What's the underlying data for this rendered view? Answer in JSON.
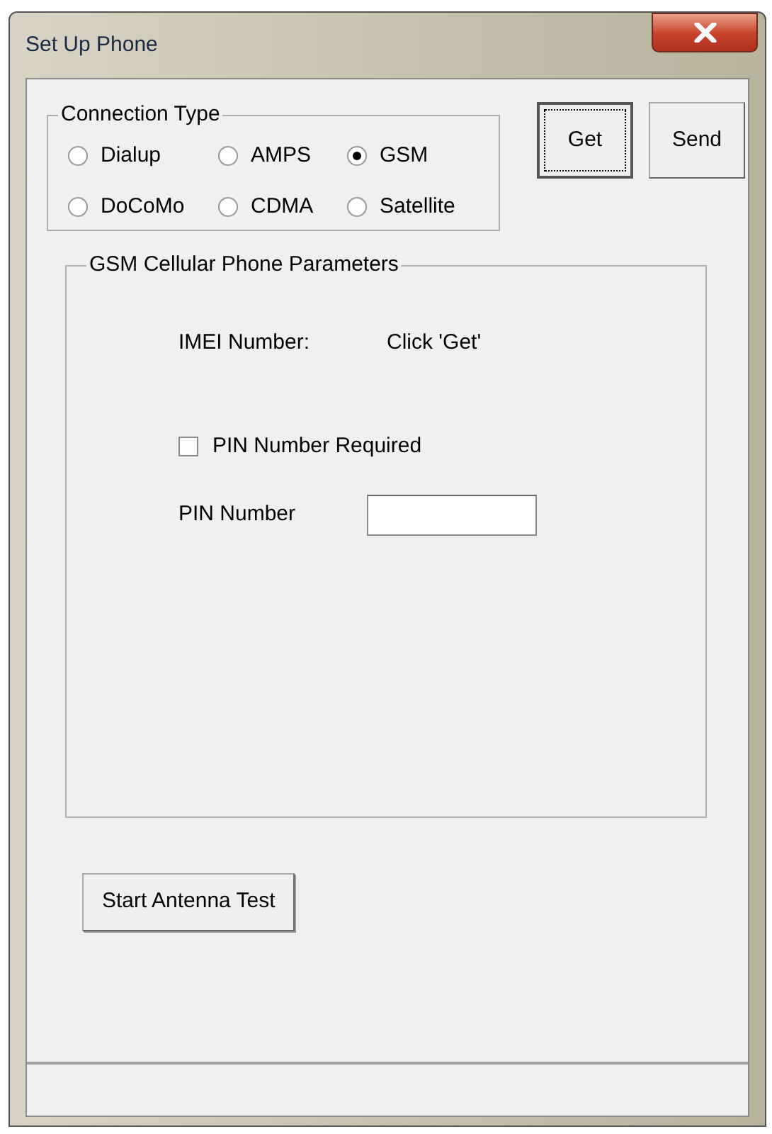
{
  "window": {
    "title": "Set Up Phone"
  },
  "connection_type": {
    "label": "Connection Type",
    "options": [
      {
        "label": "Dialup",
        "selected": false
      },
      {
        "label": "AMPS",
        "selected": false
      },
      {
        "label": "GSM",
        "selected": true
      },
      {
        "label": "DoCoMo",
        "selected": false
      },
      {
        "label": "CDMA",
        "selected": false
      },
      {
        "label": "Satellite",
        "selected": false
      }
    ]
  },
  "buttons": [
    {
      "label": "Get",
      "focused": true
    },
    {
      "label": "Send",
      "focused": false
    }
  ],
  "parameters": {
    "label": "GSM Cellular Phone Parameters",
    "imei_label": "IMEI Number:",
    "imei_value": "Click 'Get'",
    "pin_required": {
      "label": "PIN Number Required",
      "checked": false
    },
    "pin_label": "PIN Number"
  },
  "antenna_button": "Start Antenna Test"
}
